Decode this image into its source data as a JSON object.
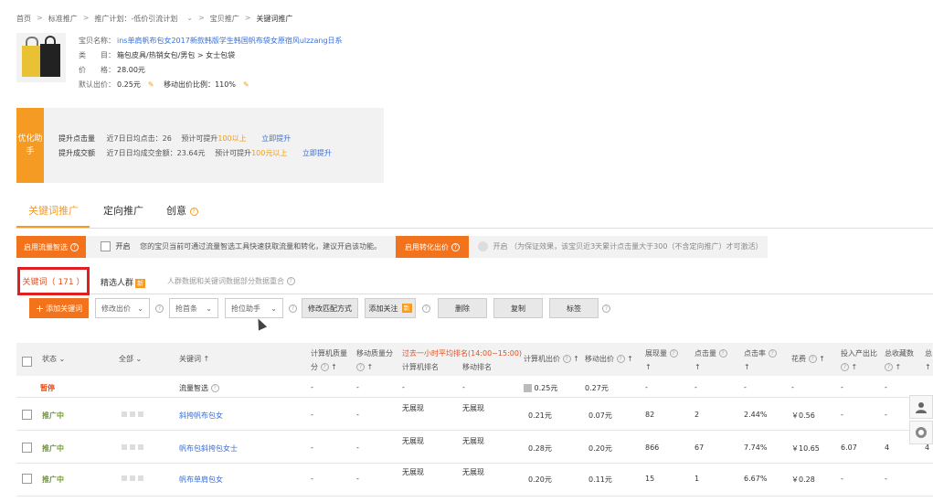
{
  "breadcrumb": [
    "首页",
    "标准推广",
    "推广计划：-低价引流计划",
    "宝贝推广",
    "关键词推广"
  ],
  "product": {
    "name_label": "宝贝名称：",
    "name_value": "ins单肩帆布包女2017新款韩版学生韩国帆布袋女原宿风ulzzang日系",
    "category_label": "类　　目：",
    "category_value": "箱包皮具/热销女包/男包 > 女士包袋",
    "price_label": "价　　格：",
    "price_value": "28.00元",
    "default_bid_label": "默认出价：",
    "default_bid_value": "0.25元",
    "mobile_ratio_label": "移动出价比例：",
    "mobile_ratio_value": "110%"
  },
  "helper": {
    "tag": "优化助手",
    "row1": {
      "title": "提升点击量",
      "desc": "近7日日均点击：26",
      "expect": "预计可提升",
      "expect_val": "100以上",
      "link": "立即提升"
    },
    "row2": {
      "title": "提升成交额",
      "desc": "近7日日均成交金额：23.64元",
      "expect": "预计可提升",
      "expect_val": "100元以上",
      "link": "立即提升"
    }
  },
  "tabs": {
    "keyword": "关键词推广",
    "targeting": "定向推广",
    "creative": "创意"
  },
  "smart": {
    "btn": "启用流量智选",
    "toggle": "开启",
    "tip": "您的宝贝当前可通过流量智选工具快速获取流量和转化，建议开启该功能。",
    "conv_btn": "启用转化出价",
    "conv_toggle": "开启",
    "conv_tip": "（为保证效果，该宝贝近3天累计点击量大于300（不含定向推广）才可激活）"
  },
  "subtabs": {
    "keyword": "关键词（ 171 ）",
    "crowd": "精选人群",
    "new": "新",
    "note": "人群数据和关键词数据部分数据重合"
  },
  "toolbar": {
    "add": "添加关键词",
    "modify_bid": "修改出价",
    "rank": "抢首条",
    "rank_helper": "抢位助手",
    "match": "修改匹配方式",
    "follow": "添加关注",
    "follow_new": "新",
    "delete": "删除",
    "copy": "复制",
    "tag": "标签"
  },
  "thead": {
    "status": "状态",
    "all": "全部",
    "keyword": "关键词",
    "pc_quality": "计算机质量",
    "pc_quality2": "分",
    "mobile_quality": "移动质量分",
    "hour_rank": "过去一小时平均排名(14:00~15:00)",
    "pc_rank": "计算机排名",
    "mobile_rank": "移动排名",
    "pc_bid": "计算机出价",
    "mobile_bid": "移动出价",
    "impressions": "展现量",
    "clicks": "点击量",
    "ctr": "点击率",
    "cost": "花费",
    "roi": "投入产出比",
    "favs": "总收藏数",
    "more": "总"
  },
  "rows": [
    {
      "status": "暂停",
      "keyword": "流量智选",
      "pc_q": "-",
      "m_q": "-",
      "pc_rank": "-",
      "m_rank": "-",
      "pc_bid": "0.25元",
      "m_bid": "0.27元",
      "imp": "-",
      "clk": "-",
      "ctr": "-",
      "cost": "-",
      "roi": "-",
      "fav": "-"
    },
    {
      "status": "推广中",
      "keyword": "斜挎帆布包女",
      "pc_q": "-",
      "m_q": "-",
      "pc_rank": "无展现",
      "m_rank": "无展现",
      "pc_bid": "0.21元",
      "m_bid": "0.07元",
      "imp": "82",
      "clk": "2",
      "ctr": "2.44%",
      "cost": "￥0.56",
      "roi": "-",
      "fav": "-"
    },
    {
      "status": "推广中",
      "keyword": "帆布包斜挎包女士",
      "pc_q": "-",
      "m_q": "-",
      "pc_rank": "无展现",
      "m_rank": "无展现",
      "pc_bid": "0.28元",
      "m_bid": "0.20元",
      "imp": "866",
      "clk": "67",
      "ctr": "7.74%",
      "cost": "￥10.65",
      "roi": "6.07",
      "fav": "4",
      "more": "4"
    },
    {
      "status": "推广中",
      "keyword": "帆布单肩包女",
      "pc_q": "-",
      "m_q": "-",
      "pc_rank": "无展现",
      "m_rank": "无展现",
      "pc_bid": "0.20元",
      "m_bid": "0.11元",
      "imp": "15",
      "clk": "1",
      "ctr": "6.67%",
      "cost": "￥0.28",
      "roi": "-",
      "fav": "-"
    }
  ]
}
